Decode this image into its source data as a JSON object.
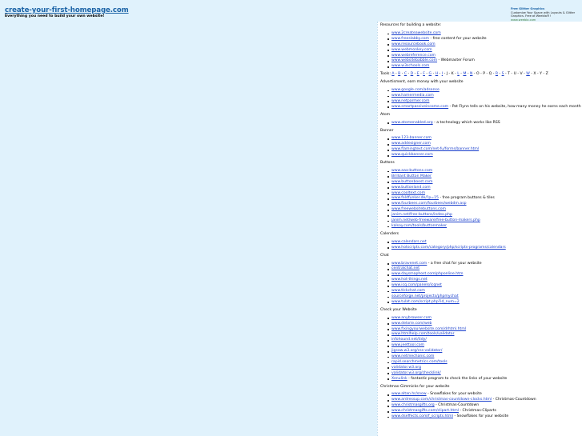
{
  "header": {
    "site_title": "create-your-first-homepage.com",
    "tagline": "Everything you need to build your own website!"
  },
  "ad": {
    "title": "Free Glitter Graphics",
    "body": "Customize Your Space with Layouts & Glitter Graphics. Free at Weebla®!",
    "url": "www.weebla.com",
    "adchoices_label": "AdChoices"
  },
  "main": {
    "intro": "Resources for building a website:",
    "resources": [
      {
        "link": "www.2createawebsite.com",
        "note": ""
      },
      {
        "link": "www.freeslabby.com",
        "note": " - free content for your website"
      },
      {
        "link": "www.resourcebook.com",
        "note": ""
      },
      {
        "link": "www.webmonkey.com",
        "note": ""
      },
      {
        "link": "www.webreference.com",
        "note": ""
      },
      {
        "link": "www.websitebabble.com",
        "note": " - Webmaster Forum"
      },
      {
        "link": "www.w3schools.com",
        "note": ""
      }
    ],
    "tools_label": "Tools:",
    "letters": [
      {
        "t": "A",
        "link": true
      },
      {
        "t": "B",
        "link": true
      },
      {
        "t": "C",
        "link": true
      },
      {
        "t": "D",
        "link": true
      },
      {
        "t": "E",
        "link": true
      },
      {
        "t": "F",
        "link": true
      },
      {
        "t": "G",
        "link": true
      },
      {
        "t": "H",
        "link": true
      },
      {
        "t": "I",
        "link": true
      },
      {
        "t": "J",
        "link": false
      },
      {
        "t": "K",
        "link": false
      },
      {
        "t": "L",
        "link": true
      },
      {
        "t": "M",
        "link": true
      },
      {
        "t": "N",
        "link": true
      },
      {
        "t": "O",
        "link": false
      },
      {
        "t": "P",
        "link": false
      },
      {
        "t": "Q",
        "link": false
      },
      {
        "t": "R",
        "link": true
      },
      {
        "t": "S",
        "link": true
      },
      {
        "t": "T",
        "link": false
      },
      {
        "t": "U",
        "link": false
      },
      {
        "t": "V",
        "link": false
      },
      {
        "t": "W",
        "link": true
      },
      {
        "t": "X",
        "link": false
      },
      {
        "t": "Y",
        "link": false
      },
      {
        "t": "Z",
        "link": false
      }
    ],
    "sections": [
      {
        "title": "Advertisment, earn money with your website",
        "items": [
          {
            "link": "www.google.com/adsense",
            "note": ""
          },
          {
            "link": "www.hamermedia.com",
            "note": ""
          },
          {
            "link": "www.netparmer.com",
            "note": ""
          },
          {
            "link": "www.smartpassiveincome.com",
            "note": " - Pat Flynn tells on his website, how many money he earns each month and"
          }
        ]
      },
      {
        "title": "Atom",
        "items": [
          {
            "link": "www.atomenabled.org",
            "note": " - a technology which works like RSS"
          }
        ]
      },
      {
        "title": "Banner",
        "items": [
          {
            "link": "www.123-banner.com",
            "note": ""
          },
          {
            "link": "www.addesigner.com",
            "note": ""
          },
          {
            "link": "www.flamingtext.com/net-fu/forms/banner.html",
            "note": ""
          },
          {
            "link": "www.quickbanner.com",
            "note": ""
          }
        ]
      },
      {
        "title": "Buttons",
        "items": [
          {
            "link": "www.aaa-buttons.com",
            "note": ""
          },
          {
            "link": "Brilliant Button Maker",
            "note": ""
          },
          {
            "link": "www.buttonboost.com",
            "note": ""
          },
          {
            "link": "www.buttonland.com",
            "note": ""
          },
          {
            "link": "www.cooltext.com",
            "note": ""
          },
          {
            "link": "www.feldfunker.de/?p=15",
            "note": " - free program buttons & tiles"
          },
          {
            "link": "www.fourbees.com/fourbees/webdm.asp",
            "note": ""
          },
          {
            "link": "www.freewebsitebuttons.com",
            "note": ""
          },
          {
            "link": "janim.net/free-buttons/index.php",
            "note": ""
          },
          {
            "link": "janim.net/web-freeware/free-button-makers.php",
            "note": ""
          },
          {
            "link": "kalsoy.com/tools/buttonmaker",
            "note": ""
          }
        ]
      },
      {
        "title": "Calenders",
        "items": [
          {
            "link": "www.calendars.net",
            "note": ""
          },
          {
            "link": "www.hotscripts.com/category/php/scripts-programs/calendars",
            "note": ""
          }
        ]
      },
      {
        "title": "Chat",
        "items": [
          {
            "link": "www.bravenet.com",
            "note": " - a free chat for your website"
          },
          {
            "link": "centralchat.net",
            "note": ""
          },
          {
            "link": "www.daysmaphost.com/phponline.htm",
            "note": ""
          },
          {
            "link": "www.hot-things.net",
            "note": ""
          },
          {
            "link": "www.icq.com/panels/icqnet",
            "note": ""
          },
          {
            "link": "www.tlckchat.com",
            "note": ""
          },
          {
            "link": "sourceforge.net/projects/phpmychat",
            "note": ""
          },
          {
            "link": "www.tulat.com/script.php?id_num=2",
            "note": ""
          }
        ]
      },
      {
        "title": "Check your Website",
        "items": [
          {
            "link": "www.anybrowser.com",
            "note": ""
          },
          {
            "link": "www.delorie.com/web",
            "note": ""
          },
          {
            "link": "www.fixingyourwebsite.com/drhtml.html",
            "note": ""
          },
          {
            "link": "www.htmlhelp.com/tools/validator",
            "note": ""
          },
          {
            "link": "infohound.net/tidy/",
            "note": ""
          },
          {
            "link": "www.jeettool.com",
            "note": ""
          },
          {
            "link": "jigsaw.w3.org/css-validator/",
            "note": ""
          },
          {
            "link": "www.netmechanic.com",
            "note": ""
          },
          {
            "link": "rapid.searchmetrics.com/tools",
            "note": ""
          },
          {
            "link": "validator.w3.org",
            "note": ""
          },
          {
            "link": "validator.w3.org/checklink/",
            "note": ""
          },
          {
            "link": "Xenulink",
            "note": " - fantastic program to check the links of your website"
          }
        ]
      },
      {
        "title": "Christmas-Gimmicks for your website",
        "items": [
          {
            "link": "www.altan.hr/snow",
            "note": " - Snowflakes for your website"
          },
          {
            "link": "www.ardressup.com/christmas-countdown-clocks.html",
            "note": " - Christmas-Countdown"
          },
          {
            "link": "www.christmasgifts.org",
            "note": " - Christmas-Countdown"
          },
          {
            "link": "www.christmasgifts.com/clipart.html",
            "note": " - Christmas-Cliparts"
          },
          {
            "link": "www.dseffects.com/f_scripts.html",
            "note": " - Snowflakes for your website"
          }
        ]
      }
    ]
  }
}
